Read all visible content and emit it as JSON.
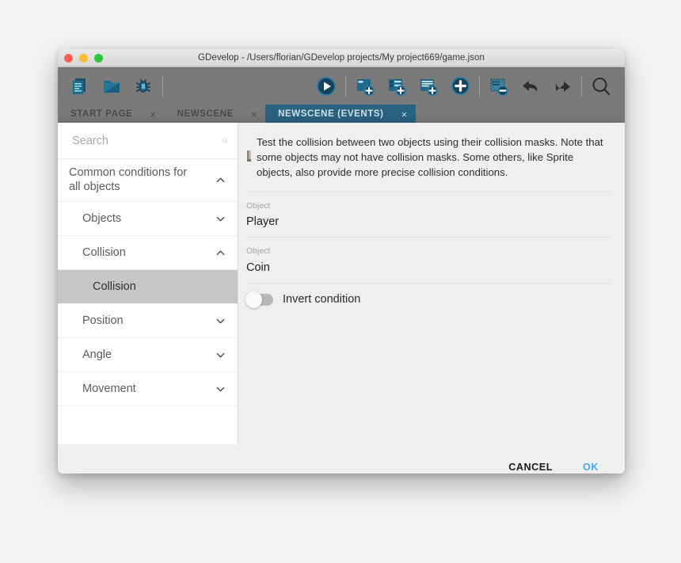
{
  "window": {
    "title": "GDevelop - /Users/florian/GDevelop projects/My project669/game.json",
    "traffic_lights": [
      "close",
      "minimize",
      "maximize"
    ],
    "accent_color": "#2a6380",
    "toolbar_bg": "#7a7a7a"
  },
  "toolbar": {
    "left_buttons": [
      {
        "name": "new-project-icon",
        "title": "New project"
      },
      {
        "name": "open-project-icon",
        "title": "Open project"
      },
      {
        "name": "debug-icon",
        "title": "Debug"
      }
    ],
    "right_buttons": [
      {
        "name": "preview-play-icon",
        "title": "Preview"
      },
      {
        "name": "add-scene-icon",
        "title": "Add scene"
      },
      {
        "name": "add-external-layout-icon",
        "title": "Add external layout"
      },
      {
        "name": "add-external-events-icon",
        "title": "Add external events"
      },
      {
        "name": "add-icon",
        "title": "Add"
      },
      {
        "name": "remove-scene-icon",
        "title": "Remove"
      },
      {
        "name": "undo-icon",
        "title": "Undo"
      },
      {
        "name": "redo-icon",
        "title": "Redo"
      },
      {
        "name": "search-icon",
        "title": "Search"
      }
    ]
  },
  "tabs": [
    {
      "label": "START PAGE",
      "active": false,
      "close": "×"
    },
    {
      "label": "NEWSCENE",
      "active": false,
      "close": "×"
    },
    {
      "label": "NEWSCENE (EVENTS)",
      "active": true,
      "close": "×"
    }
  ],
  "dialog": {
    "search": {
      "value": "",
      "placeholder": "Search",
      "icon": "search-icon"
    },
    "categories": [
      {
        "label": "Common conditions for all objects",
        "level": 0,
        "expanded": true,
        "chevron": "chevron-up-icon"
      },
      {
        "label": "Objects",
        "level": 1,
        "expanded": false,
        "chevron": "chevron-down-icon"
      },
      {
        "label": "Collision",
        "level": 1,
        "expanded": true,
        "chevron": "chevron-up-icon"
      },
      {
        "label": "Position",
        "level": 1,
        "expanded": false,
        "chevron": "chevron-down-icon"
      },
      {
        "label": "Angle",
        "level": 1,
        "expanded": false,
        "chevron": "chevron-down-icon"
      },
      {
        "label": "Movement",
        "level": 1,
        "expanded": false,
        "chevron": "chevron-down-icon"
      }
    ],
    "selected_item": {
      "label": "Collision",
      "selected": true
    },
    "description": "Test the collision between two objects using their collision masks. Note that some objects may not have collision masks. Some others, like Sprite objects, also provide more precise collision conditions.",
    "fields": [
      {
        "label": "Object",
        "value": "Player"
      },
      {
        "label": "Object",
        "value": "Coin"
      }
    ],
    "toggle": {
      "label": "Invert condition",
      "on": false
    },
    "footer": {
      "cancel_label": "CANCEL",
      "ok_label": "OK",
      "ok_color": "#3fa9f5"
    }
  }
}
